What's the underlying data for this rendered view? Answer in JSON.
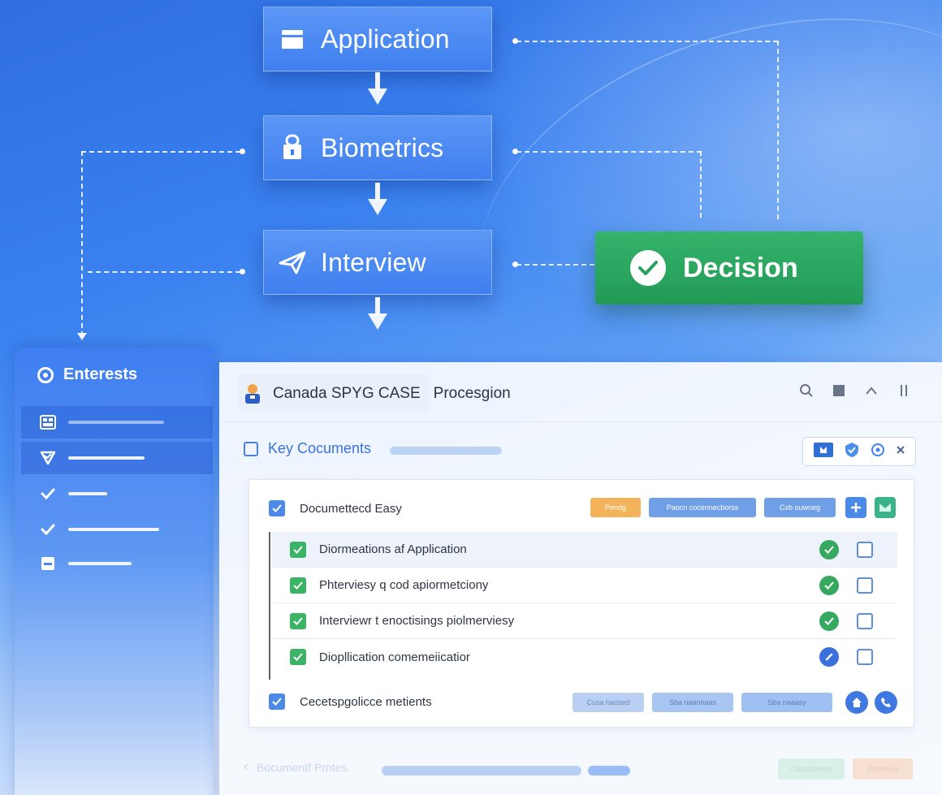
{
  "flow": {
    "steps": [
      {
        "label": "Application",
        "icon": "document-icon"
      },
      {
        "label": "Biometrics",
        "icon": "lock-icon"
      },
      {
        "label": "Interview",
        "icon": "send-icon"
      }
    ],
    "decision": {
      "label": "Decision",
      "icon": "check-circle-icon"
    }
  },
  "sidebar": {
    "title": "Enterests",
    "items": [
      {
        "icon": "grid-icon",
        "active": true
      },
      {
        "icon": "shield-check-icon",
        "active": true
      },
      {
        "icon": "check-icon",
        "active": false
      },
      {
        "icon": "check-icon",
        "active": false
      },
      {
        "icon": "minus-square-icon",
        "active": false
      }
    ]
  },
  "header": {
    "case_title": "Canada SPYG CASE",
    "case_subtitle": "Procesgion",
    "tools": [
      "search-icon",
      "stop-icon",
      "chevron-up-icon",
      "pause-icon"
    ]
  },
  "section": {
    "title": "Key Cocuments",
    "actions": [
      "flag-icon",
      "shield-check-icon",
      "settings-circle-icon",
      "close-icon"
    ]
  },
  "documents": {
    "header_label": "Documettecd Easy",
    "header_pills": [
      "Pendg",
      "Paocn cocennecborss",
      "Cxb ouwneg"
    ],
    "rows": [
      {
        "label": "Diormeations af Application",
        "status": "complete"
      },
      {
        "label": "Phterviesy q cod apiormetciony",
        "status": "complete"
      },
      {
        "label": "Interviewr t enoctisings piolmerviesy",
        "status": "complete"
      },
      {
        "label": "Diopllication comemeiicatior",
        "status": "in-progress"
      }
    ],
    "footer_label": "Cecetspgolicce metients",
    "footer_pills": [
      "Cusa haosed",
      "Sba naaonaas",
      "Sba naaasy"
    ]
  },
  "bottom": {
    "label": "Bocumentf Prntes.",
    "pills": [
      "Cucastemno",
      "Peceinoo"
    ]
  },
  "colors": {
    "accent": "#3f7ff0",
    "success": "#2ea862",
    "warning": "#f3b35a"
  }
}
